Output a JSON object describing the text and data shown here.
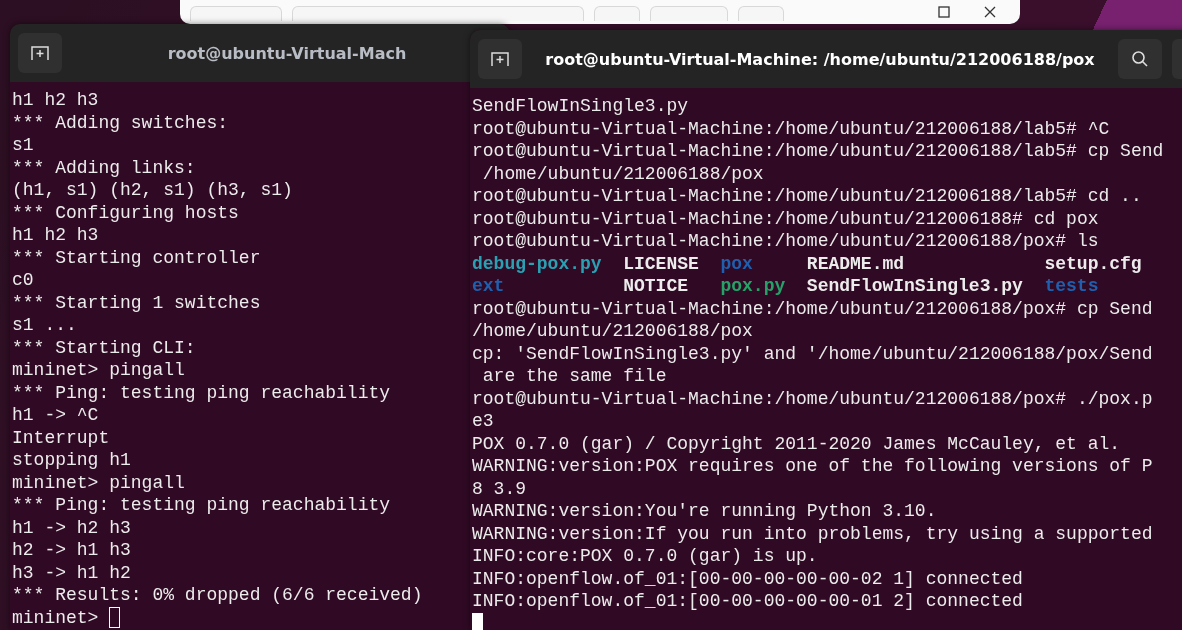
{
  "terminals": [
    {
      "title": "root@ubuntu-Virtual-Mach",
      "focused": false,
      "cursor_on_new_line": false,
      "lines": [
        {
          "kind": "text",
          "text": "h1 h2 h3"
        },
        {
          "kind": "text",
          "text": "*** Adding switches:"
        },
        {
          "kind": "text",
          "text": "s1"
        },
        {
          "kind": "text",
          "text": "*** Adding links:"
        },
        {
          "kind": "text",
          "text": "(h1, s1) (h2, s1) (h3, s1)"
        },
        {
          "kind": "text",
          "text": "*** Configuring hosts"
        },
        {
          "kind": "text",
          "text": "h1 h2 h3"
        },
        {
          "kind": "text",
          "text": "*** Starting controller"
        },
        {
          "kind": "text",
          "text": "c0"
        },
        {
          "kind": "text",
          "text": "*** Starting 1 switches"
        },
        {
          "kind": "text",
          "text": "s1 ..."
        },
        {
          "kind": "text",
          "text": "*** Starting CLI:"
        },
        {
          "kind": "text",
          "text": "mininet> pingall"
        },
        {
          "kind": "text",
          "text": "*** Ping: testing ping reachability"
        },
        {
          "kind": "text",
          "text": "h1 -> ^C"
        },
        {
          "kind": "text",
          "text": "Interrupt"
        },
        {
          "kind": "text",
          "text": "stopping h1"
        },
        {
          "kind": "text",
          "text": "mininet> pingall"
        },
        {
          "kind": "text",
          "text": "*** Ping: testing ping reachability"
        },
        {
          "kind": "text",
          "text": "h1 -> h2 h3"
        },
        {
          "kind": "text",
          "text": "h2 -> h1 h3"
        },
        {
          "kind": "text",
          "text": "h3 -> h1 h2"
        },
        {
          "kind": "text",
          "text": "*** Results: 0% dropped (6/6 received)"
        },
        {
          "kind": "text",
          "text": "mininet>"
        }
      ]
    },
    {
      "title": "root@ubuntu-Virtual-Machine: /home/ubuntu/212006188/pox",
      "focused": true,
      "cursor_on_new_line": true,
      "lines": [
        {
          "kind": "text",
          "text": "SendFlowInSingle3.py"
        },
        {
          "kind": "text",
          "text": "root@ubuntu-Virtual-Machine:/home/ubuntu/212006188/lab5# ^C"
        },
        {
          "kind": "text",
          "text": "root@ubuntu-Virtual-Machine:/home/ubuntu/212006188/lab5# cp Send"
        },
        {
          "kind": "text",
          "text": " /home/ubuntu/212006188/pox"
        },
        {
          "kind": "text",
          "text": "root@ubuntu-Virtual-Machine:/home/ubuntu/212006188/lab5# cd .."
        },
        {
          "kind": "text",
          "text": "root@ubuntu-Virtual-Machine:/home/ubuntu/212006188# cd pox"
        },
        {
          "kind": "text",
          "text": "root@ubuntu-Virtual-Machine:/home/ubuntu/212006188/pox# ls"
        },
        {
          "kind": "listing",
          "entries": [
            {
              "name": "debug-pox.py",
              "color": "#2aa1b3"
            },
            {
              "name": "LICENSE",
              "color": "#ececec"
            },
            {
              "name": "pox",
              "color": "#1f5fae"
            },
            {
              "name": "README.md",
              "color": "#ececec"
            },
            {
              "name": "setup.cfg",
              "color": "#ececec"
            }
          ]
        },
        {
          "kind": "listing",
          "entries": [
            {
              "name": "ext",
              "color": "#1f5fae"
            },
            {
              "name": "NOTICE",
              "color": "#ececec"
            },
            {
              "name": "pox.py",
              "color": "#26a269"
            },
            {
              "name": "SendFlowInSingle3.py",
              "color": "#ececec"
            },
            {
              "name": "tests",
              "color": "#1f5fae"
            }
          ]
        },
        {
          "kind": "text",
          "text": "root@ubuntu-Virtual-Machine:/home/ubuntu/212006188/pox# cp Send"
        },
        {
          "kind": "text",
          "text": "/home/ubuntu/212006188/pox"
        },
        {
          "kind": "text",
          "text": "cp: 'SendFlowInSingle3.py' and '/home/ubuntu/212006188/pox/Send"
        },
        {
          "kind": "text",
          "text": " are the same file"
        },
        {
          "kind": "text",
          "text": "root@ubuntu-Virtual-Machine:/home/ubuntu/212006188/pox# ./pox.p"
        },
        {
          "kind": "text",
          "text": "e3"
        },
        {
          "kind": "text",
          "text": "POX 0.7.0 (gar) / Copyright 2011-2020 James McCauley, et al."
        },
        {
          "kind": "text",
          "text": "WARNING:version:POX requires one of the following versions of P"
        },
        {
          "kind": "text",
          "text": "8 3.9"
        },
        {
          "kind": "text",
          "text": "WARNING:version:You're running Python 3.10."
        },
        {
          "kind": "text",
          "text": "WARNING:version:If you run into problems, try using a supported"
        },
        {
          "kind": "text",
          "text": "INFO:core:POX 0.7.0 (gar) is up."
        },
        {
          "kind": "text",
          "text": "INFO:openflow.of_01:[00-00-00-00-00-02 1] connected"
        },
        {
          "kind": "text",
          "text": "INFO:openflow.of_01:[00-00-00-00-00-01 2] connected"
        }
      ]
    }
  ]
}
